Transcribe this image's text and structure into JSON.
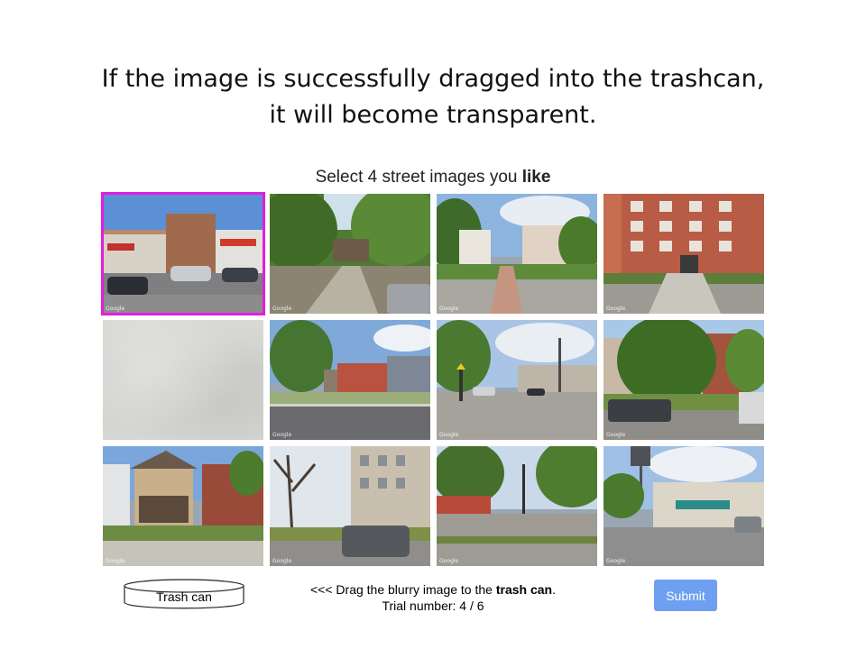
{
  "caption": {
    "line1": "If the image is successfully dragged into the trashcan,",
    "line2": "it will become transparent."
  },
  "prompt": {
    "prefix": "Select 4 street images you ",
    "emphasis": "like"
  },
  "images": [
    {
      "label": "Google",
      "selected": true
    },
    {
      "label": "Google",
      "selected": false
    },
    {
      "label": "Google",
      "selected": false
    },
    {
      "label": "Google",
      "selected": false
    },
    {
      "label": "",
      "selected": false,
      "blurry": true
    },
    {
      "label": "Google",
      "selected": false
    },
    {
      "label": "Google",
      "selected": false
    },
    {
      "label": "Google",
      "selected": false
    },
    {
      "label": "Google",
      "selected": false
    },
    {
      "label": "Google",
      "selected": false
    },
    {
      "label": "Google",
      "selected": false
    },
    {
      "label": "Google",
      "selected": false
    }
  ],
  "trash": {
    "label": "Trash can"
  },
  "instructions": {
    "prefix": "<<< Drag the blurry image to the ",
    "emphasis": "trash can",
    "suffix": ".",
    "trial_label": "Trial number: 4 / 6"
  },
  "submit": {
    "label": "Submit"
  },
  "colors": {
    "selection": "#e51be0",
    "submit": "#6e9ff0"
  }
}
